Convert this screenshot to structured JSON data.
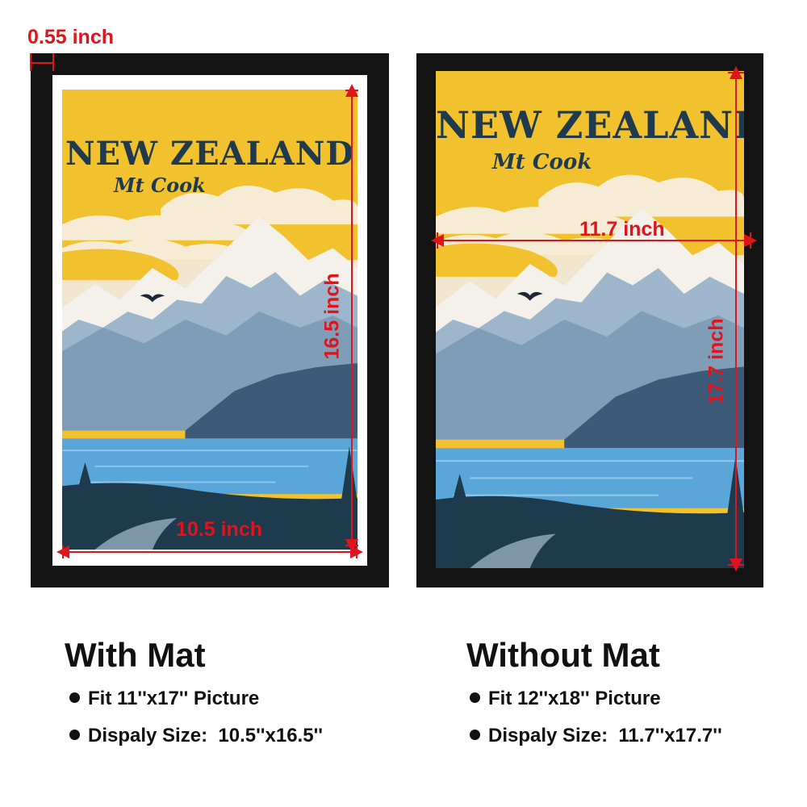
{
  "poster": {
    "title": "NEW ZEALAND",
    "subtitle": "Mt Cook"
  },
  "with_mat": {
    "heading": "With Mat",
    "mat_width_label": "0.55 inch",
    "height_label": "16.5 inch",
    "width_label": "10.5 inch",
    "fit_label": "Fit 11''x17'' Picture",
    "display_label": "Dispaly Size:  10.5''x16.5''"
  },
  "without_mat": {
    "heading": "Without Mat",
    "height_label": "17.7 inch",
    "width_label": "11.7 inch",
    "fit_label": "Fit 12''x18'' Picture",
    "display_label": "Dispaly Size:  11.7''x17.7''"
  },
  "colors": {
    "frame": "#131313",
    "mat": "#ffffff",
    "sky_yellow": "#f2c12e",
    "title_navy": "#1f3a4d",
    "dimension_red": "#e0141c",
    "lake_blue": "#5aa6d8"
  }
}
